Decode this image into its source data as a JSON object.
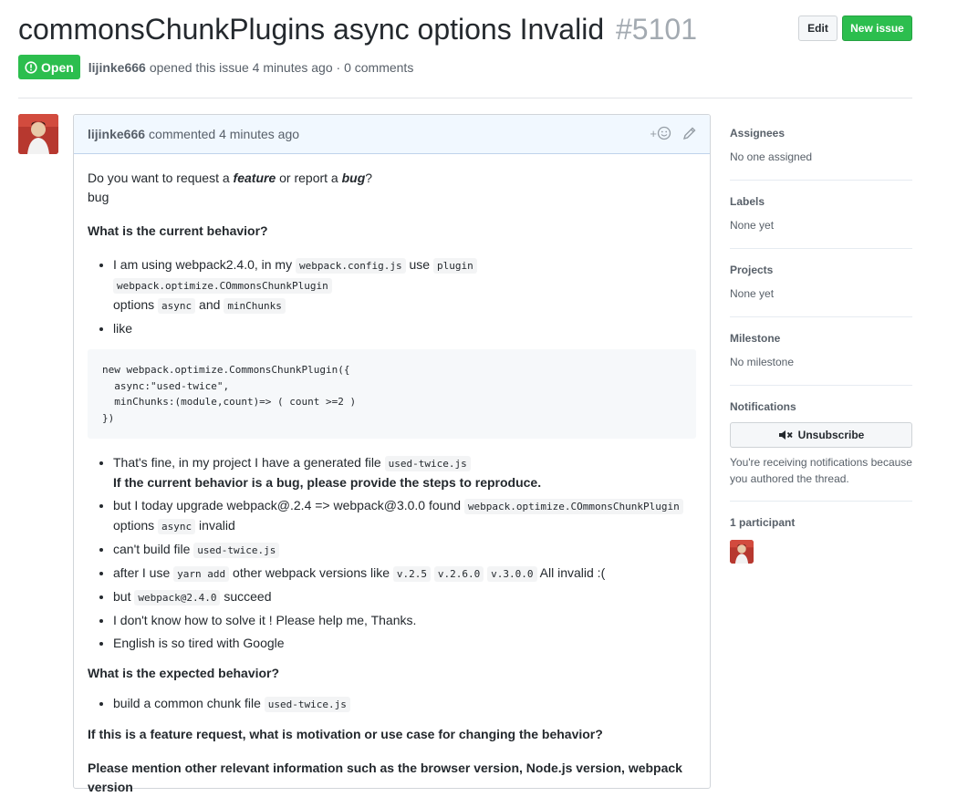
{
  "issue": {
    "title": "commonsChunkPlugins async options Invalid",
    "number": "#5101",
    "state": "Open",
    "author": "lijinke666",
    "opened_text": "opened this issue 4 minutes ago · 0 comments"
  },
  "header_buttons": {
    "edit": "Edit",
    "new_issue": "New issue"
  },
  "comment": {
    "author": "lijinke666",
    "time_text": "commented 4 minutes ago",
    "react": "+",
    "intro": {
      "pre": "Do you want to request a ",
      "feature": "feature",
      "mid": " or report a ",
      "bug": "bug",
      "post": "?"
    },
    "answer": "bug",
    "current_heading": "What is the current behavior?",
    "li1": {
      "t1": "I am using webpack2.4.0, in my ",
      "c1": "webpack.config.js",
      "t2": " use ",
      "c2": "plugin",
      "c3": "webpack.optimize.COmmonsChunkPlugin",
      "t3": "options ",
      "c4": "async",
      "t4": " and ",
      "c5": "minChunks"
    },
    "li2": "like",
    "code": "new webpack.optimize.CommonsChunkPlugin({\n  async:\"used-twice\",\n  minChunks:(module,count)=> ( count >=2 )\n})",
    "li3": {
      "t1": "That's fine, in my project I have a generated file ",
      "c1": "used-twice.js",
      "bold": "If the current behavior is a bug, please provide the steps to reproduce."
    },
    "li4": {
      "t1": "but I today upgrade webpack@.2.4 => webpack@3.0.0 found ",
      "c1": "webpack.optimize.COmmonsChunkPlugin",
      "t2": "options ",
      "c2": "async",
      "t3": " invalid"
    },
    "li5": {
      "t1": "can't build file ",
      "c1": "used-twice.js"
    },
    "li6": {
      "t1": "after I use ",
      "c1": "yarn add",
      "t2": " other webpack versions like ",
      "c2": "v.2.5",
      "c3": "v.2.6.0",
      "c4": "v.3.0.0",
      "t3": " All invalid :("
    },
    "li7": {
      "t1": "but ",
      "c1": "webpack@2.4.0",
      "t2": " succeed"
    },
    "li8": "I don't know how to solve it ! Please help me, Thanks.",
    "li9": "English is so tired with Google",
    "expected_heading": "What is the expected behavior?",
    "li10": {
      "t1": "build a common chunk file ",
      "c1": "used-twice.js"
    },
    "feature_heading": "If this is a feature request, what is motivation or use case for changing the behavior?",
    "other_heading": "Please mention other relevant information such as the browser version, Node.js version, webpack version"
  },
  "sidebar": {
    "assignees": {
      "label": "Assignees",
      "value": "No one assigned"
    },
    "labels": {
      "label": "Labels",
      "value": "None yet"
    },
    "projects": {
      "label": "Projects",
      "value": "None yet"
    },
    "milestone": {
      "label": "Milestone",
      "value": "No milestone"
    },
    "notifications": {
      "label": "Notifications",
      "button": "Unsubscribe",
      "note": "You're receiving notifications because you authored the thread."
    },
    "participants": {
      "label": "1 participant"
    }
  },
  "colors": {
    "open_green": "#2cbe4e",
    "header_blue": "#f1f8ff",
    "muted": "#586069"
  }
}
